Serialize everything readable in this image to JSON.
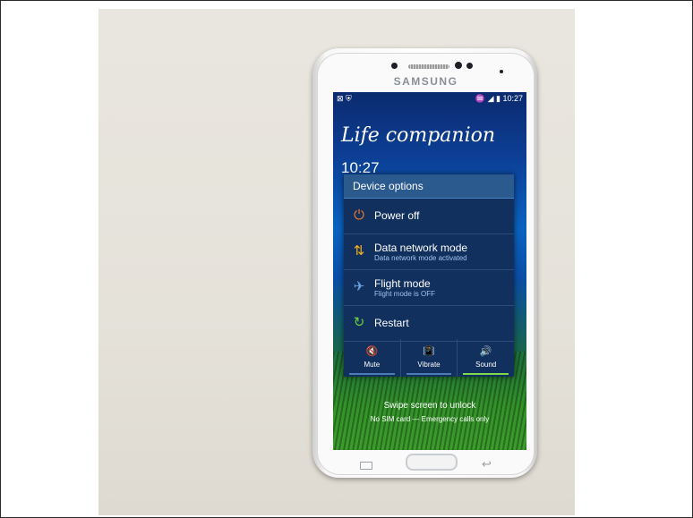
{
  "phone": {
    "brand": "SAMSUNG",
    "status_bar": {
      "left_icons": "⊠ ⛨",
      "right_icons": "♒ ◢ ▮",
      "time": "10:27"
    },
    "lockscreen": {
      "tagline": "Life companion",
      "clock_partial": "10:27",
      "swipe_hint": "Swipe screen to unlock",
      "sim_status": "No SIM card — Emergency calls only"
    },
    "device_options": {
      "title": "Device options",
      "items": [
        {
          "label": "Power off",
          "sublabel": "",
          "icon": "power-icon",
          "color": "#f07a2a"
        },
        {
          "label": "Data network mode",
          "sublabel": "Data network mode activated",
          "icon": "data-network-icon",
          "color": "#f0b020"
        },
        {
          "label": "Flight mode",
          "sublabel": "Flight mode is OFF",
          "icon": "airplane-icon",
          "color": "#6aa0e0"
        },
        {
          "label": "Restart",
          "sublabel": "",
          "icon": "restart-icon",
          "color": "#6ed03a"
        }
      ],
      "sound_modes": [
        {
          "label": "Mute",
          "icon": "mute-icon",
          "active": false
        },
        {
          "label": "Vibrate",
          "icon": "vibrate-icon",
          "active": false
        },
        {
          "label": "Sound",
          "icon": "sound-icon",
          "active": true
        }
      ]
    }
  }
}
